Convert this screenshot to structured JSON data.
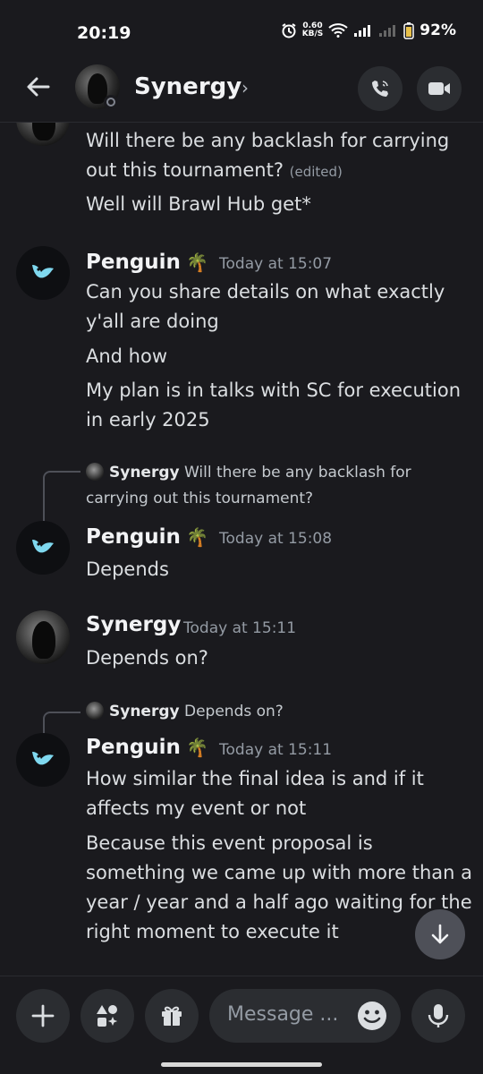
{
  "status_bar": {
    "time": "20:19",
    "net_speed_value": "0.60",
    "net_speed_unit": "KB/S",
    "battery": "92%"
  },
  "header": {
    "title": "Synergy",
    "chevron": "›",
    "call_icon": "phone-icon",
    "video_icon": "video-camera-icon"
  },
  "messages": [
    {
      "id": "m0",
      "lines": [
        "Will there be any backlash for carrying",
        "out this tournament?",
        "Well will Brawl Hub get*"
      ],
      "edited_label": "(edited)"
    },
    {
      "id": "m1",
      "author": "Penguin",
      "emoji": "🌴",
      "timestamp": "Today at 15:07",
      "lines": [
        "Can you share details on what exactly",
        "y'all are doing",
        "And how",
        "My plan is in talks with SC for execution",
        "in early 2025"
      ]
    },
    {
      "id": "m2",
      "reply_author": "Synergy",
      "reply_text_1": "Will there be any backlash for",
      "reply_text_2": "carrying out this tournament?",
      "author": "Penguin",
      "emoji": "🌴",
      "timestamp": "Today at 15:08",
      "lines": [
        "Depends"
      ]
    },
    {
      "id": "m3",
      "author": "Synergy",
      "timestamp": "Today at 15:11",
      "lines": [
        "Depends on?"
      ]
    },
    {
      "id": "m4",
      "reply_author": "Synergy",
      "reply_text_1": "Depends on?",
      "author": "Penguin",
      "emoji": "🌴",
      "timestamp": "Today at 15:11",
      "lines": [
        "How similar the final idea is and if it",
        "affects my event or not",
        "Because this event proposal is",
        "something we came up with more than a",
        "year / year and a half ago waiting for the",
        "right moment to execute it"
      ]
    }
  ],
  "composer": {
    "placeholder": "Message ...",
    "plus_icon": "plus-icon",
    "apps_icon": "apps-icon",
    "gift_icon": "gift-icon",
    "emoji_icon": "emoji-icon",
    "mic_icon": "microphone-icon"
  },
  "colors": {
    "background": "#1a1a1e",
    "text": "#dbdee1",
    "muted": "#949ba4",
    "button": "#2b2d31"
  }
}
